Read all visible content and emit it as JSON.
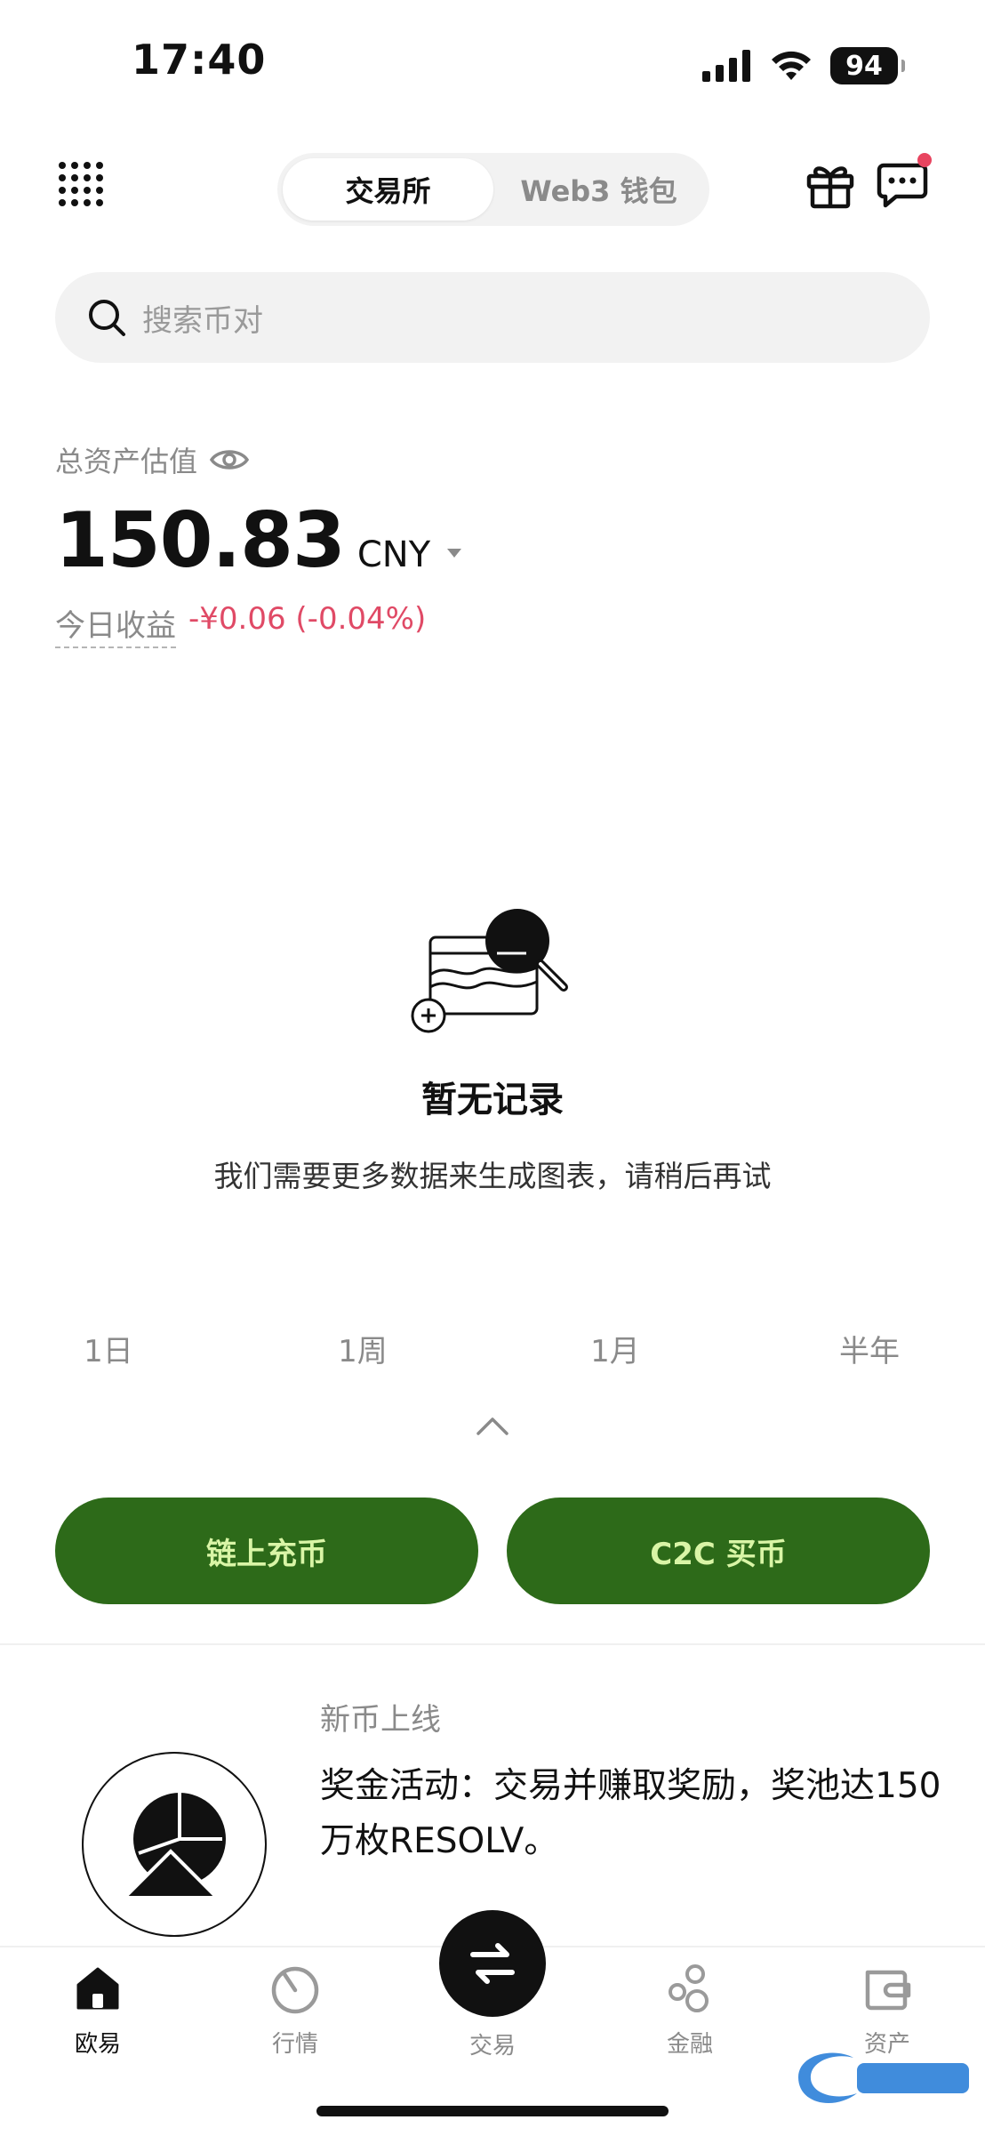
{
  "status_bar": {
    "time": "17:40",
    "battery": "94"
  },
  "header": {
    "tabs": [
      {
        "label": "交易所",
        "active": true
      },
      {
        "label": "Web3 钱包",
        "active": false
      }
    ],
    "icons": [
      "apps-grid-icon",
      "gift-icon",
      "message-icon"
    ],
    "notification_dot_color": "#e8445f"
  },
  "search": {
    "placeholder": "搜索币对"
  },
  "assets": {
    "label": "总资产估值",
    "value": "150.83",
    "currency": "CNY",
    "pnl_label": "今日收益",
    "pnl_value": "-¥0.06 (-0.04%)",
    "pnl_color": "#e04a66"
  },
  "empty_state": {
    "title": "暂无记录",
    "description": "我们需要更多数据来生成图表，请稍后再试"
  },
  "periods": [
    "1日",
    "1周",
    "1月",
    "半年"
  ],
  "actions": {
    "onchain_deposit": "链上充币",
    "c2c_buy": "C2C 买币",
    "button_bg": "#2d6a19",
    "button_text_color": "#d9f5a6"
  },
  "promo": {
    "tag": "新币上线",
    "text": "奖金活动：交易并赚取奖励，奖池达150万枚RESOLV。"
  },
  "bottom_nav": [
    {
      "label": "欧易",
      "icon": "home-icon",
      "active": true
    },
    {
      "label": "行情",
      "icon": "market-icon",
      "active": false
    },
    {
      "label": "交易",
      "icon": "swap-icon",
      "active": false
    },
    {
      "label": "金融",
      "icon": "finance-icon",
      "active": false
    },
    {
      "label": "资产",
      "icon": "wallet-icon",
      "active": false
    }
  ]
}
